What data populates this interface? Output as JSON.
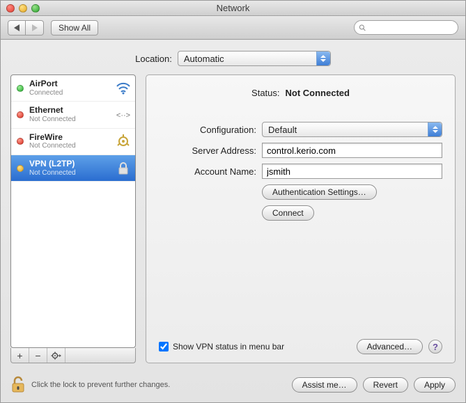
{
  "window": {
    "title": "Network"
  },
  "toolbar": {
    "show_all": "Show All",
    "search_placeholder": ""
  },
  "location": {
    "label": "Location:",
    "value": "Automatic"
  },
  "services": [
    {
      "name": "AirPort",
      "status": "Connected",
      "dot": "green",
      "icon": "wifi"
    },
    {
      "name": "Ethernet",
      "status": "Not Connected",
      "dot": "red",
      "icon": "ethernet"
    },
    {
      "name": "FireWire",
      "status": "Not Connected",
      "dot": "red",
      "icon": "firewire"
    },
    {
      "name": "VPN (L2TP)",
      "status": "Not Connected",
      "dot": "yellow",
      "icon": "lock",
      "selected": true
    }
  ],
  "detail": {
    "status_label": "Status:",
    "status_value": "Not Connected",
    "configuration_label": "Configuration:",
    "configuration_value": "Default",
    "server_label": "Server Address:",
    "server_value": "control.kerio.com",
    "account_label": "Account Name:",
    "account_value": "jsmith",
    "auth_settings_btn": "Authentication Settings…",
    "connect_btn": "Connect",
    "show_vpn_checkbox": "Show VPN status in menu bar",
    "show_vpn_checked": true,
    "advanced_btn": "Advanced…"
  },
  "footer": {
    "lock_text": "Click the lock to prevent further changes.",
    "assist_btn": "Assist me…",
    "revert_btn": "Revert",
    "apply_btn": "Apply"
  }
}
